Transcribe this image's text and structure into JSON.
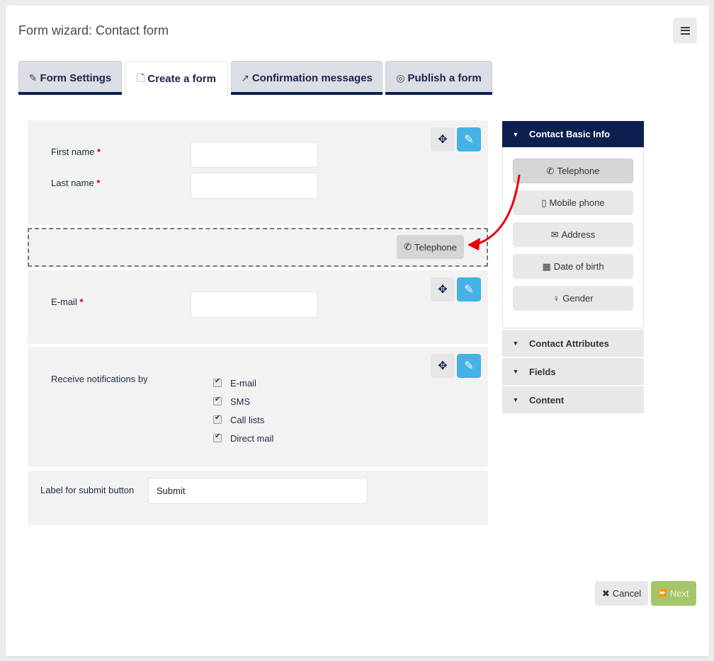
{
  "header": {
    "title": "Form wizard: Contact form",
    "menu_icon": "hamburger-icon"
  },
  "tabs": [
    {
      "label": "Form Settings",
      "icon": "✎",
      "active": false
    },
    {
      "label": "Create a form",
      "icon": "🗋",
      "active": true
    },
    {
      "label": "Confirmation messages",
      "icon": "↗",
      "active": false
    },
    {
      "label": "Publish a form",
      "icon": "◎",
      "active": false
    }
  ],
  "form": {
    "required_mark": "*",
    "first_name": {
      "label": "First name",
      "value": ""
    },
    "last_name": {
      "label": "Last name",
      "value": ""
    },
    "dropzone": {
      "chip_label": "Telephone",
      "chip_icon": "✆"
    },
    "email": {
      "label": "E-mail",
      "value": ""
    },
    "notifications": {
      "label": "Receive notifications by",
      "options": [
        {
          "label": "E-mail",
          "checked": true
        },
        {
          "label": "SMS",
          "checked": true
        },
        {
          "label": "Call lists",
          "checked": true
        },
        {
          "label": "Direct mail",
          "checked": true
        }
      ]
    },
    "submit_label": {
      "label": "Label for submit button",
      "value": "Submit"
    }
  },
  "controls": {
    "move_icon": "✥",
    "edit_icon": "✎"
  },
  "panel": {
    "header": "Contact Basic Info",
    "items": [
      {
        "label": "Telephone",
        "icon": "✆"
      },
      {
        "label": "Mobile phone",
        "icon": "▯"
      },
      {
        "label": "Address",
        "icon": "✉"
      },
      {
        "label": "Date of birth",
        "icon": "▦"
      },
      {
        "label": "Gender",
        "icon": "♀"
      }
    ],
    "sections": [
      "Contact Attributes",
      "Fields",
      "Content"
    ],
    "triangle": "▼"
  },
  "footer": {
    "cancel_label": "Cancel",
    "cancel_icon": "✖",
    "next_label": "Next",
    "next_icon": "⏩"
  },
  "colors": {
    "primary": "#0c1f4e",
    "edit": "#45b2e6",
    "next": "#a5c66b",
    "arrow": "#e8000b"
  }
}
